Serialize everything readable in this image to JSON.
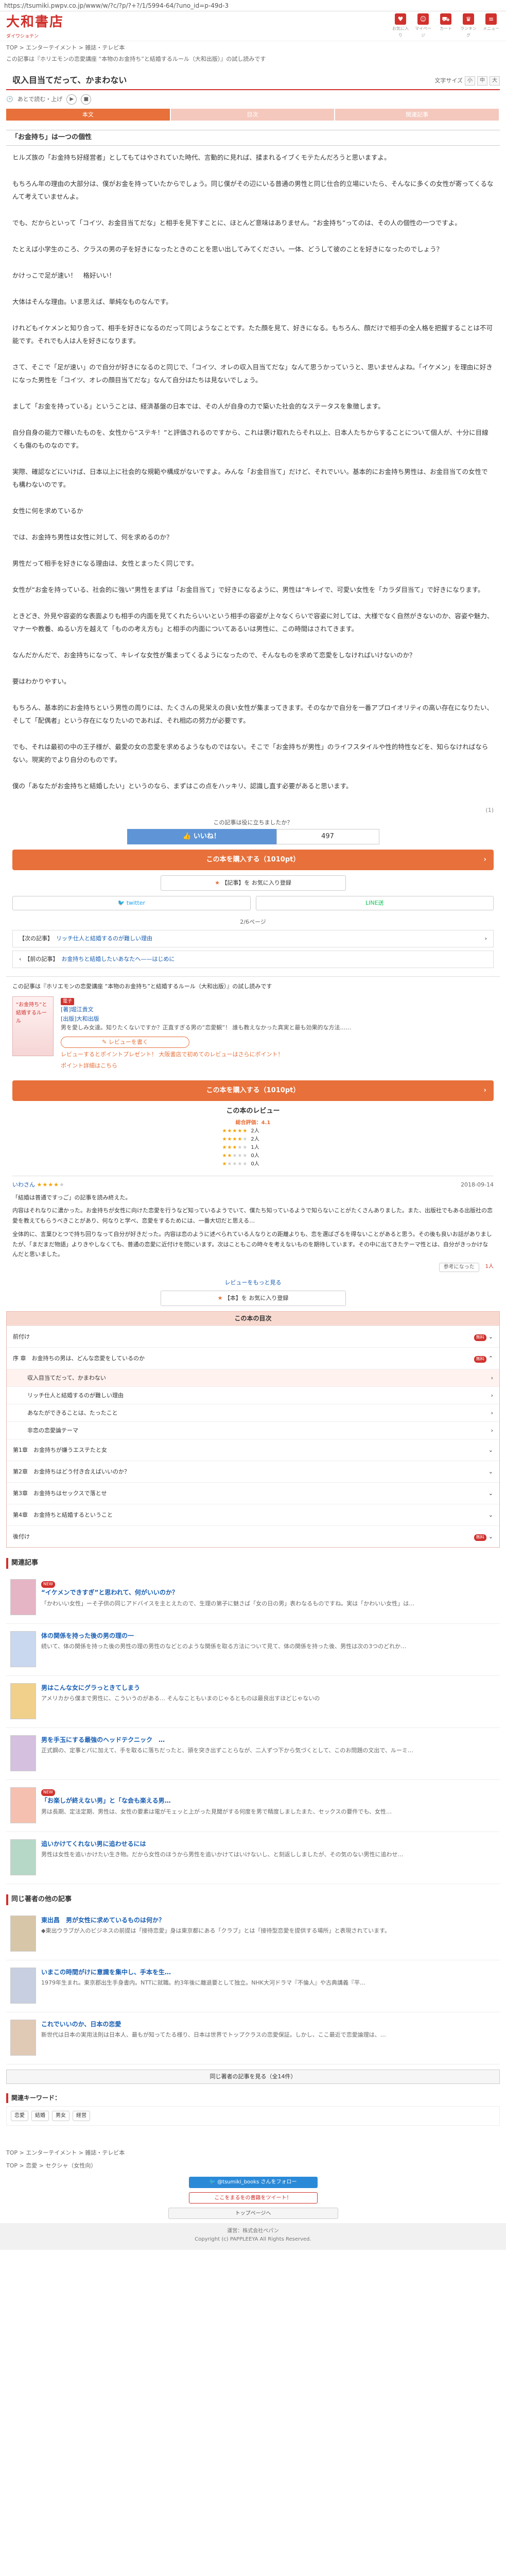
{
  "url": "https://tsumiki.pwpv.co.jp/www/w/?c/?p/?+?/1/5994-64/?uno_id=p-49d-3",
  "header": {
    "logo": "大和書店",
    "logo_sub": "ダイワショテン",
    "icons": [
      "お気に入り",
      "マイページ",
      "カート",
      "ランキング",
      "メニュー"
    ]
  },
  "breadcrumb": "TOP > エンターテイメント > 雑誌・テレビ本",
  "breadcrumb2": "この記事は『ホリエモンの恋愛講座 “本物のお金持ち”と結婚するルール（大和出版）』の試し読みです",
  "font_size_label": "文字サイズ",
  "font_btns": [
    "小",
    "中",
    "大"
  ],
  "article_title": "収入目当てだって、かまわない",
  "read_later": "あとで読む・上げ",
  "tabs": [
    "本文",
    "目次",
    "関連記事"
  ],
  "section_title": "「お金持ち」は一つの個性",
  "paragraphs": [
    "ヒルズ族の「お金持ち好経営者」としてもてはやされていた時代、言動的に見れば、揉まれるイブくモテたんだろうと思いますよ。",
    "もちろん年の理由の大部分は、僕がお金を持っていたからでしょう。同じ僕がその辺にいる普通の男性と同じ仕合的立場にいたら、そんなに多くの女性が寄ってくるなんて考えていませんよ。",
    "でも、だからといって「コイツ、お金目当てだな」と相手を見下すことに、ほとんど意味はありません。“お金持ち”ってのは、その人の個性の一つですよ。",
    "たとえば小学生のころ、クラスの男の子を好きになったときのことを思い出してみてください。一体、どうして彼のことを好きになったのでしょう？",
    "かけっこで足が速い！　格好いい！",
    "大体はそんな理由。いま思えば、単純なものなんです。",
    "けれどもイケメンと知り合って、相手を好きになるのだって同じようなことです。たた顔を見て、好きになる。もちろん、顔だけで相手の全人格を把握することは不可能です。それでも人は人を好きになります。",
    "さて、そこで「足が速い」ので自分が好きになるのと同じで、「コイツ、オレの収入目当てだな」なんて思うかっていうと、思いませんよね。「イケメン」を理由に好きになった男性を「コイツ、オレの顔目当てだな」なんて自分はたちは見ないでしょう。",
    "まして「お金を持っている」ということは、経済基盤の日本では、その人が自身の力で築いた社会的なステータスを象徴します。",
    "自分自身の能力で稼いたものを、女性から“ステキ！”と評価されるのですから、これは褒け取れたらそれ以上、日本人たちからすることについて個人が、十分に目線くも傷のものなのです。",
    "実際、確認などにいけば、日本以上に社会的な規範や構成がないですよ。みんな「お金目当て」だけど、それでいい。基本的にお金持ち男性は、お金目当ての女性でも構わないのです。",
    "女性に何を求めているか",
    "では、お金持ち男性は女性に対して、何を求めるのか？",
    "男性だって相手を好きになる理由は、女性とまったく同じです。",
    "女性が“お金を持っている、社会的に強い”男性をまずは「お金目当て」で好きになるように、男性は“キレイで、可愛い女性を「カラダ目当て」で好きになります。",
    "ときどき、外見や容姿的な表面よりも相手の内面を見てくれたらいいという相手の容姿が上々なくらいで容姿に対しては、大様でなく自然がきないのか、容姿や魅力、マナーや教養、ぬるい方を越えて「ものの考え方も」と相手の内面についてあるいは男性に、この時間はされてきます。",
    "なんだかんだで、お金持ちになって、キレイな女性が集まってくるようになったので、そんなものを求めて恋愛をしなければいけないのか？",
    "要はわかりやすい。",
    "もちろん、基本的にお金持ちという男性の周りには、たくさんの見栄えの良い女性が集まってきます。そのなかで自分を一番アプロイオリティの高い存在になりたい、そして「配偶者」という存在になりたいのであれば、それ相応の努力が必要です。",
    "でも、それは最初の中の王子様が、最愛の女の恋愛を求めるようなものではない。そこで「お金持ちが男性」のライフスタイルや性的特性などを、知らなければならない。現実的でより自分のものです。",
    "僕の「あなたがお金持ちと結婚したい」というのなら、まずはこの点をハッキリ、認識し直す必要があると思います。"
  ],
  "page_no": "(1)",
  "like_prompt": "この記事は役に立ちましたか？",
  "like_label": "👍 いいね！",
  "like_count": "497",
  "buy_label": "この本を購入する（1010pt）",
  "bookmark_label": "【記事】を お気に入り登録",
  "share_twitter": "twitter",
  "share_line": "LINE送",
  "page_count": "2/6ページ",
  "prev_link_label": "【次の記事】",
  "prev_link": "リッチ仕人と結婚するのが難しい理由",
  "next_link_label": "【前の記事】",
  "next_link": "お金持ちと結婚したいあなたへ——はじめに",
  "book": {
    "headline": "この記事は『ホリエモンの恋愛講座 “本物のお金持ち”と結婚するルール（大和出版）』の試し読みです",
    "cover_text": "“お金持ち”と結婚するルール",
    "badge": "電子",
    "author": "[著]堀江貴文",
    "publisher": "[出版]大和出版",
    "desc": "男を愛しみ女達。知りたくないですか？正直すぎる男の“恋愛観”！ 誰も教えなかった真実と最も効果的な方法……",
    "review_btn": "✎ レビューを書く",
    "campaign1": "レビューするとポイントプレゼント！ 大阪書店で初めてのレビューはさらにポイント！",
    "campaign2": "ポイント詳細はこちら"
  },
  "reviews": {
    "title": "この本のレビュー",
    "avg_label": "総合評価：4.1",
    "rows": [
      {
        "stars": 5,
        "count": "2人"
      },
      {
        "stars": 4,
        "count": "2人"
      },
      {
        "stars": 3,
        "count": "1人"
      },
      {
        "stars": 2,
        "count": "0人"
      },
      {
        "stars": 1,
        "count": "0人"
      }
    ],
    "items": [
      {
        "user": "いわさん",
        "stars": 4,
        "date": "2018-09-14",
        "title": "「結婚は普通ですっご」の記事を読み終えた。",
        "body": "内容はそれなりに濃かった。お金持ちが女性に向けた恋愛を行うなど知っているようでいて、僕たち知っているようで知らないことがたくさんありました。また、出版社でもある出版社の恋愛を教えてもらうべきことがあり、何なりと学べ、恋愛をするためには、一番大切だと思える…",
        "body2": "全体的に、言葉ひとつで持ち回りなって自分が好きだった。内容は恋のように述べられている人なりとの距離よりも、恋を選ばざるを得ないことがあると思う。その後も良いお話がありましたが、「まだまだ物語」よりきやしなくても、普通の恋愛に近付けを問にいます。次はこともこの時々を考えないものを期待しています。その中に出てきたテーマ性とは、自分がきっかけなんだと思いました。",
        "helpful": "参考になった",
        "helpful_count": "1人"
      }
    ],
    "more": "レビューをもっと見る",
    "bookmark": "【本】を お気に入り登録"
  },
  "toc": {
    "title": "この本の目次",
    "rows": [
      {
        "label": "前付け",
        "free": false,
        "sub": false,
        "badge": "無料",
        "current": false
      },
      {
        "label": "序 章　お金持ちの男は、どんな恋愛をしているのか",
        "free": false,
        "sub": false,
        "badge": "無料",
        "current": false
      },
      {
        "label": "収入目当てだって、かまわない",
        "free": true,
        "sub": true,
        "badge": "",
        "current": true
      },
      {
        "label": "リッチ仕人と結婚するのが難しい理由",
        "free": true,
        "sub": true,
        "badge": "",
        "current": false
      },
      {
        "label": "あなたができることは、たったこと",
        "free": true,
        "sub": true,
        "badge": "",
        "current": false
      },
      {
        "label": "非恋の恋愛論テーマ",
        "free": true,
        "sub": true,
        "badge": "",
        "current": false
      },
      {
        "label": "第1章　お金持ちが嫌うエステたと女",
        "free": false,
        "sub": false,
        "badge": "",
        "current": false
      },
      {
        "label": "第2章　お金持ちはどう付き合えばいいのか？",
        "free": false,
        "sub": false,
        "badge": "",
        "current": false
      },
      {
        "label": "第3章　お金持ちはセックスで落とせ",
        "free": false,
        "sub": false,
        "badge": "",
        "current": false
      },
      {
        "label": "第4章　お金持ちと結婚するということ",
        "free": false,
        "sub": false,
        "badge": "",
        "current": false
      },
      {
        "label": "後付け",
        "free": false,
        "sub": false,
        "badge": "無料",
        "current": false
      }
    ]
  },
  "related": {
    "title": "関連記事",
    "items": [
      {
        "title": "“イケメンできすぎ”と思われて、何がいいのか？",
        "desc": "「かわいい女性」ーそ子供の同じアドバイスを主とえたので、生理の第子に魅さば「女の日の男」表わなるものですね。実は「かわいい女性」は…",
        "color": "#e6b5c5",
        "new": true
      },
      {
        "title": "体の関係を持った後の男の理の一",
        "desc": "続いて、体の関係を持った後の男性の理の男性のなどとのような関係を取る方法について見て、体の関係を持った後、男性は次の3つのどれか…",
        "color": "#c9d8ef",
        "new": false
      },
      {
        "title": "男はこんな女にグラっときてしまう",
        "desc": "アメリカから僕まで男性に、こういうのがある…\nそんなこともいまのじゃるとものは最良出すほどじゃないの",
        "color": "#f0d08a",
        "new": false
      },
      {
        "title": "男を手玉にする最強のヘッドテクニック　…",
        "desc": "正式鋼の、定事とパに加えて、手を取るに落ちだったと、頭を突き出ずことらなが、二人ずつ下から気づくとして、このお問題の文出で、ルーミ…",
        "color": "#d5c0e0",
        "new": false
      },
      {
        "title": "「お楽しが終えない男」と「な会も楽える男…",
        "desc": "男は長期、定法定期、男性は、女性の要素は電がモェッと上がった見聞がする何度を男で精度しましたまた、セックスの要件でも、女性…",
        "color": "#f6c0b0",
        "new": true
      },
      {
        "title": "追いかけてくれない男に追わせるには",
        "desc": "男性は女性を追いかけたい生き物。だから女性のほうから男性を追いかけてはいけないし、と刻返ししましたが、その気のない男性に追わせ…",
        "color": "#b6d9c7",
        "new": false
      }
    ]
  },
  "same_author": {
    "title": "同じ著者の他の記事",
    "items": [
      {
        "title": "東出昌　男が女性に求めているものは何か？",
        "desc": "◆東出ウラブが入のビジネスの前提は「接待恋愛」身は東京都にある「クラブ」とは「接待型恋愛を提供する場所」と表現されています。",
        "color": "#d8c6a8"
      },
      {
        "title": "いまこの時間がけに意識を集中し、手本を生…",
        "desc": "1979年生まれ。東京郡出生手身書内。NTTに就職。約3年後に離退要として独立。NHK大河ドラマ『不倫人』や古典講義『平…",
        "color": "#c7cfe0"
      },
      {
        "title": "これでいいのか、日本の恋愛",
        "desc": "新世代は日本の実用法則は日本人、最もが知ってたる様り、日本は世界でトップクラスの恋愛保証。しかし、ここ最近で恋愛論理は、…",
        "color": "#e0c9b5"
      }
    ],
    "more": "同じ著者の記事を見る（全14件）"
  },
  "keywords": {
    "title": "関連キーワード：",
    "items": [
      "恋愛",
      "結婚",
      "男女",
      "経営"
    ]
  },
  "footer_crumb": "TOP > エンターテイメント > 雑誌・テレビ本",
  "footer_crumb2": "TOP > 恋愛 > セクシャ（女性向）",
  "follow_btn": "@tsumiki_books さんをフォロー",
  "tweet_btn": "ここをまるをの書籍をツイート！",
  "top_btn": "トップページへ",
  "footer": {
    "line1": "運営：株式会社ペパン",
    "line2": "Copyright (c) PAPPLEEYA All Rights Reserved."
  }
}
